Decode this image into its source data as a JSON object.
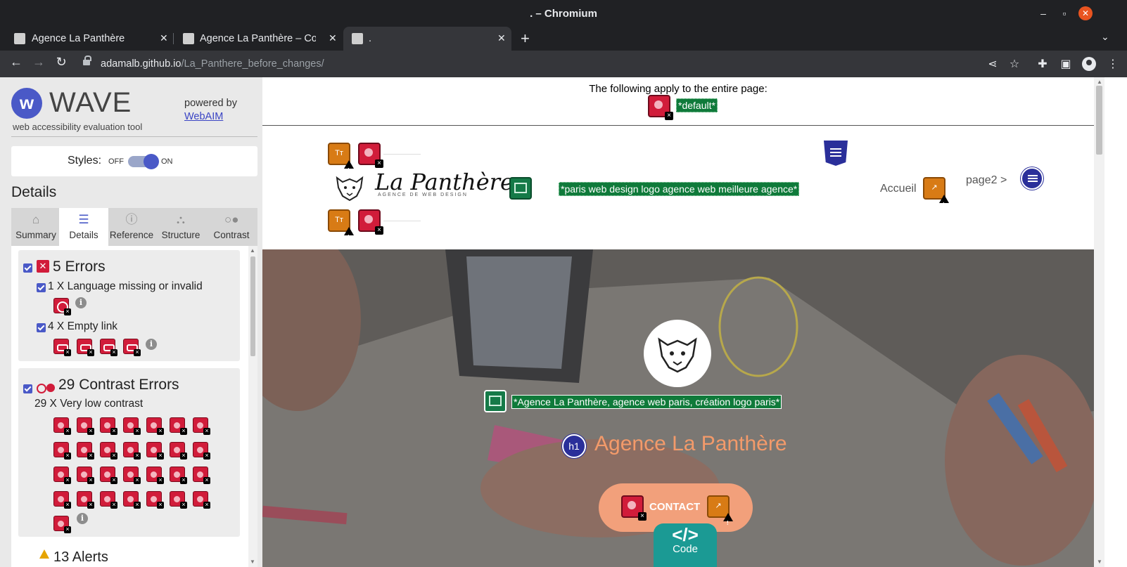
{
  "window": {
    "title": ". – Chromium"
  },
  "tabs": [
    {
      "label": "Agence La Panthère"
    },
    {
      "label": "Agence La Panthère – Con"
    },
    {
      "label": "."
    }
  ],
  "address": {
    "host": "adamalb.github.io",
    "path": "/La_Panthere_before_changes/"
  },
  "wave": {
    "brand": "WAVE",
    "tagline": "web accessibility evaluation tool",
    "powered_by": "powered by",
    "webaim": "WebAIM",
    "styles_label": "Styles:",
    "styles_off": "OFF",
    "styles_on": "ON",
    "details_heading": "Details",
    "tabs": [
      {
        "label": "Summary",
        "icon": "home-icon"
      },
      {
        "label": "Details",
        "icon": "list-icon"
      },
      {
        "label": "Reference",
        "icon": "info-icon"
      },
      {
        "label": "Structure",
        "icon": "hierarchy-icon"
      },
      {
        "label": "Contrast",
        "icon": "contrast-icon"
      }
    ],
    "errors": {
      "title": "5 Errors",
      "items": [
        {
          "label": "1 X Language missing or invalid",
          "count": 1,
          "icon": "language-error-icon"
        },
        {
          "label": "4 X Empty link",
          "count": 4,
          "icon": "empty-link-icon"
        }
      ]
    },
    "contrast": {
      "title": "29 Contrast Errors",
      "items": [
        {
          "label": "29 X Very low contrast",
          "count": 29,
          "icon": "contrast-error-icon"
        }
      ]
    },
    "alerts_peek": "13 Alerts"
  },
  "page": {
    "apply_text": "The following apply to the entire page:",
    "default_tag": "*default*",
    "logo_text": "La Panthère",
    "logo_subtext": "AGENCE DE WEB DESIGN",
    "logo_alt_tag": "*paris web design logo agence web meilleure agence*",
    "nav_home": "Accueil",
    "nav_page2": "page2 >",
    "hero_alt_tag": "*Agence La Panthère, agence web paris, création logo paris*",
    "hero_title": "Agence La Panthère",
    "h1_badge": "h1",
    "contact_label": "CONTACT",
    "code_glyph": "</>",
    "code_label": "Code",
    "text_icon_label": "Tт"
  },
  "colors": {
    "wave_accent": "#4a59c7",
    "error_red": "#d11c3a",
    "alert_orange": "#d87b15",
    "feature_green": "#157a48",
    "structure_navy": "#2a2f9a",
    "hero_title": "#f39a6a"
  }
}
